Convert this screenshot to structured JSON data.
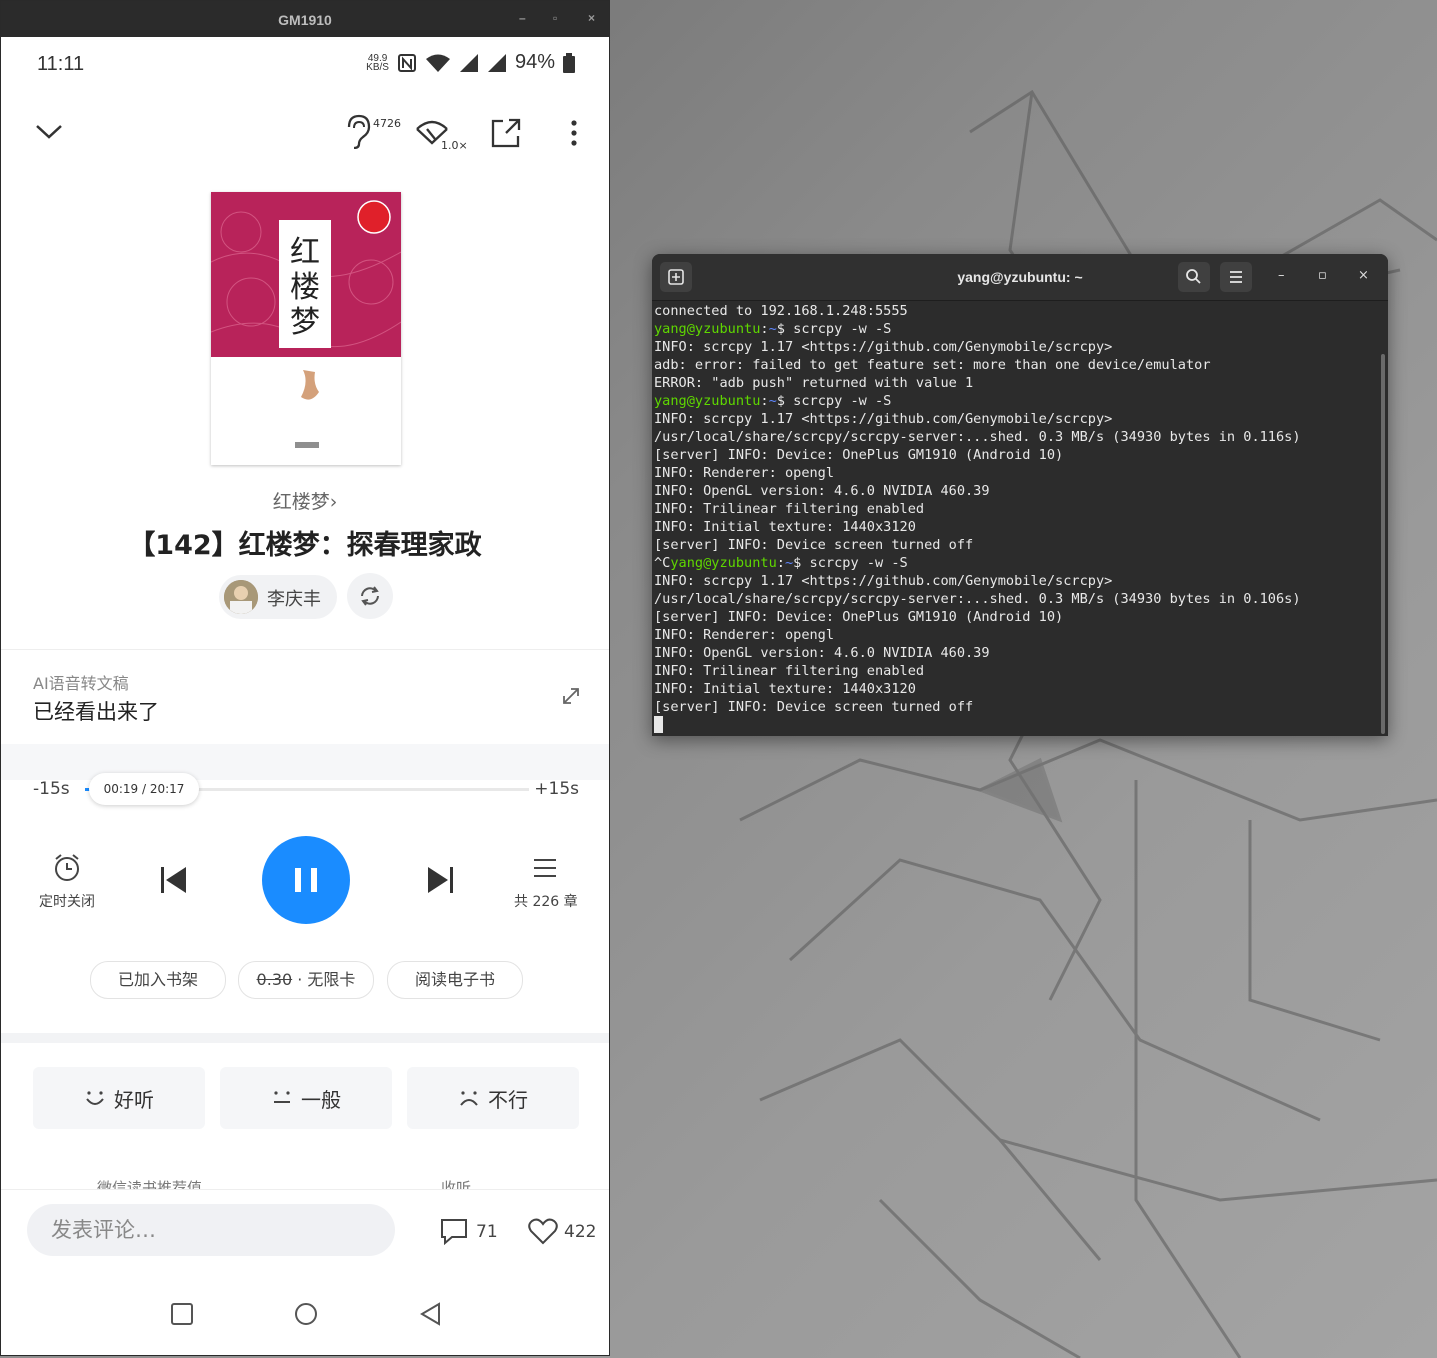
{
  "phone_window": {
    "title": "GM1910",
    "controls": [
      "–",
      "▫",
      "×"
    ]
  },
  "status_bar": {
    "time": "11:11",
    "speed_value": "49.9",
    "speed_unit": "KB/S",
    "battery": "94%"
  },
  "player_top": {
    "listeners": "4726",
    "speed": "1.0×"
  },
  "book": {
    "name": "红楼梦",
    "chevron": "›",
    "episode_title": "【142】红楼梦：探春理家政",
    "author": "李庆丰"
  },
  "ai_transcript": {
    "label": "AI语音转文稿",
    "text": "已经看出来了"
  },
  "progress": {
    "back_label": "-15s",
    "forward_label": "+15s",
    "time": "00:19 / 20:17",
    "fraction": 0.016
  },
  "controls": {
    "timer_label": "定时关闭",
    "chapters_label": "共 226 章"
  },
  "pills": {
    "shelf": "已加入书架",
    "price": "0.30",
    "price_suffix": " · 无限卡",
    "read": "阅读电子书"
  },
  "rating": {
    "good": "好听",
    "ok": "一般",
    "bad": "不行"
  },
  "faded_labels": {
    "left": "微信读书推荐值",
    "right": "收听"
  },
  "bottom": {
    "comment_placeholder": "发表评论…",
    "comments_count": "71",
    "likes_count": "422"
  },
  "terminal": {
    "title": "yang@yzubuntu: ~",
    "controls": [
      "–",
      "▫",
      "×"
    ],
    "user": "yang@yzubuntu",
    "path": "~",
    "lines": [
      {
        "type": "out",
        "text": "connected to 192.168.1.248:5555"
      },
      {
        "type": "cmd",
        "prefix": "",
        "cmd": "$ scrcpy -w -S"
      },
      {
        "type": "out",
        "text": "INFO: scrcpy 1.17 <https://github.com/Genymobile/scrcpy>"
      },
      {
        "type": "out",
        "text": "adb: error: failed to get feature set: more than one device/emulator"
      },
      {
        "type": "out",
        "text": "ERROR: \"adb push\" returned with value 1"
      },
      {
        "type": "cmd",
        "prefix": "",
        "cmd": "$ scrcpy -w -S"
      },
      {
        "type": "out",
        "text": "INFO: scrcpy 1.17 <https://github.com/Genymobile/scrcpy>"
      },
      {
        "type": "out",
        "text": "/usr/local/share/scrcpy/scrcpy-server:...shed. 0.3 MB/s (34930 bytes in 0.116s)"
      },
      {
        "type": "out",
        "text": "[server] INFO: Device: OnePlus GM1910 (Android 10)"
      },
      {
        "type": "out",
        "text": "INFO: Renderer: opengl"
      },
      {
        "type": "out",
        "text": "INFO: OpenGL version: 4.6.0 NVIDIA 460.39"
      },
      {
        "type": "out",
        "text": "INFO: Trilinear filtering enabled"
      },
      {
        "type": "out",
        "text": "INFO: Initial texture: 1440x3120"
      },
      {
        "type": "out",
        "text": "[server] INFO: Device screen turned off"
      },
      {
        "type": "cmd",
        "prefix": "^C",
        "cmd": "$ scrcpy -w -S"
      },
      {
        "type": "out",
        "text": "INFO: scrcpy 1.17 <https://github.com/Genymobile/scrcpy>"
      },
      {
        "type": "out",
        "text": "/usr/local/share/scrcpy/scrcpy-server:...shed. 0.3 MB/s (34930 bytes in 0.106s)"
      },
      {
        "type": "out",
        "text": "[server] INFO: Device: OnePlus GM1910 (Android 10)"
      },
      {
        "type": "out",
        "text": "INFO: Renderer: opengl"
      },
      {
        "type": "out",
        "text": "INFO: OpenGL version: 4.6.0 NVIDIA 460.39"
      },
      {
        "type": "out",
        "text": "INFO: Trilinear filtering enabled"
      },
      {
        "type": "out",
        "text": "INFO: Initial texture: 1440x3120"
      },
      {
        "type": "out",
        "text": "[server] INFO: Device screen turned off"
      }
    ]
  }
}
